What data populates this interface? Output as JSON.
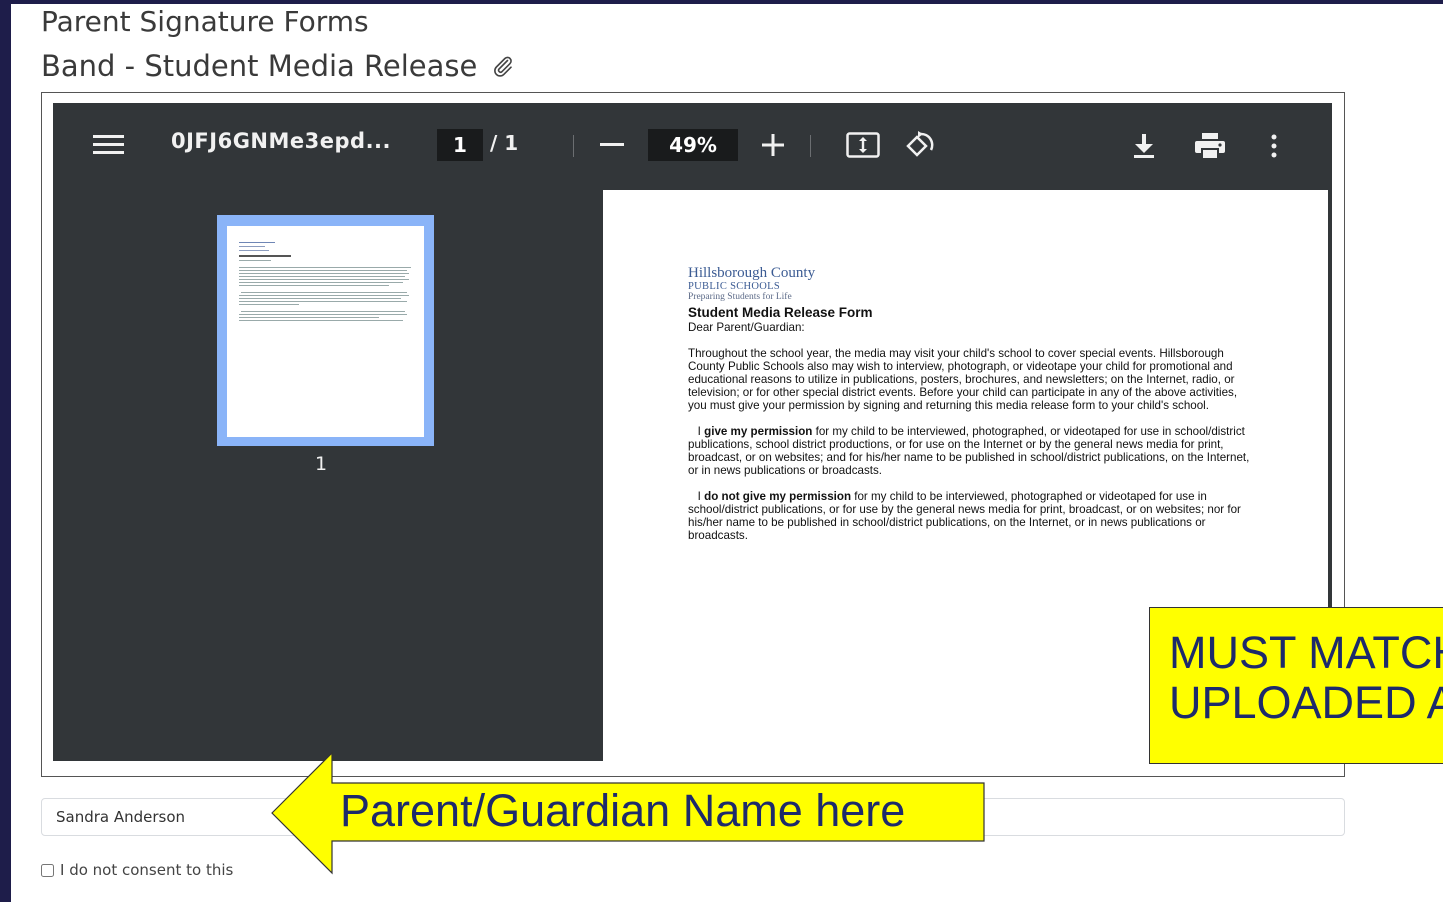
{
  "header": {
    "section_title": "Parent Signature Forms",
    "form_title": "Band - Student Media Release"
  },
  "viewer": {
    "filename": "0JFJ6GNMe3epd...",
    "current_page": "1",
    "page_total": "/  1",
    "zoom": "49%",
    "thumbnail_label": "1",
    "icons": [
      "menu-icon",
      "zoom-out-icon",
      "zoom-in-icon",
      "fit-page-icon",
      "rotate-icon",
      "download-icon",
      "print-icon",
      "more-icon"
    ]
  },
  "document": {
    "org_line1": "Hillsborough County",
    "org_line2": "PUBLIC SCHOOLS",
    "org_line3": "Preparing Students for Life",
    "title": "Student Media Release Form",
    "greeting": "Dear Parent/Guardian:",
    "intro": "Throughout the school year, the media may visit your child's school to cover special events. Hillsborough County Public Schools also may wish to interview, photograph, or videotape your child for promotional and educational reasons to utilize in publications, posters, brochures, and newsletters; on the Internet, radio, or television; or for other special district events. Before your child can participate in any of the above activities, you must give your permission by signing and returning this media release form to your child's school.",
    "give_prefix": "I",
    "give_bold": "give my permission",
    "give_rest": "for my child to be interviewed, photographed, or videotaped for use in school/district publications, school district productions, or for use on the Internet or by the general news media for print, broadcast, or on websites; and for his/her name to be published in school/district publications, on the Internet, or in news publications or broadcasts.",
    "deny_prefix": "I",
    "deny_bold": "do not give my permission",
    "deny_rest": "for my child to be interviewed, photographed or videotaped for use in school/district publications, or for use by the general news media for print, broadcast, or on websites; nor for his/her name to be published in school/district publications, on the Internet, or in news publications or broadcasts."
  },
  "form": {
    "name_value": "Sandra Anderson",
    "consent_label": "I do not consent to this"
  },
  "annotations": {
    "match_line1": "MUST MATCH",
    "match_line2": "UPLOADED AT",
    "name_hint": "Parent/Guardian Name here",
    "callout_color": "#ffff00",
    "callout_text_color": "#1d2a6b"
  }
}
